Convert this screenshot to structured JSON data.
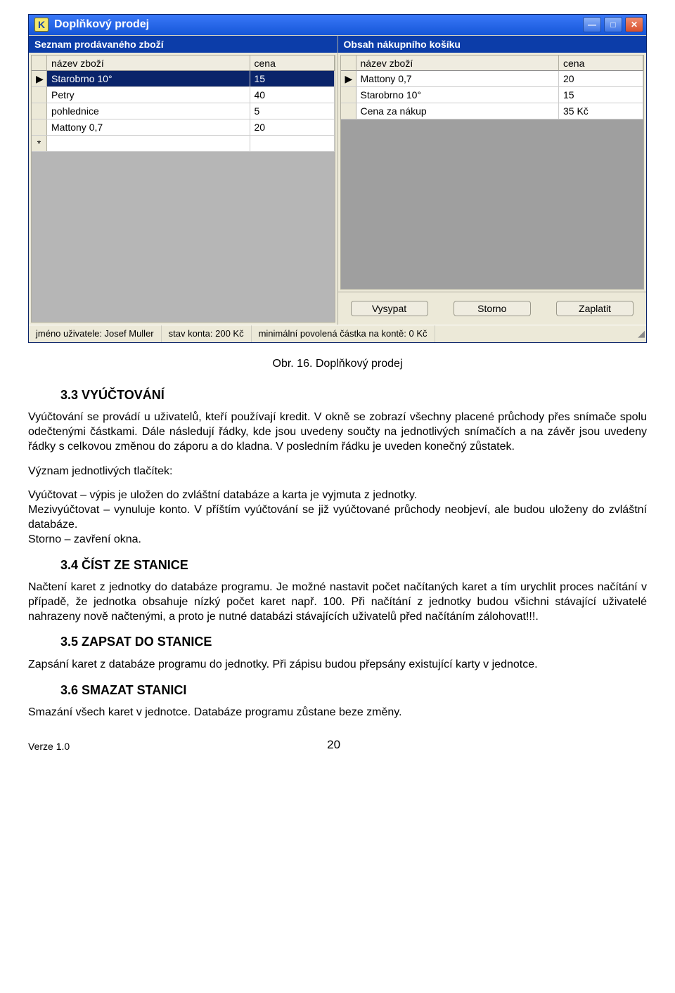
{
  "window": {
    "title": "Doplňkový prodej",
    "icon_letter": "K",
    "left_pane_title": "Seznam prodávaného zboží",
    "right_pane_title": "Obsah nákupního košíku",
    "columns": {
      "name": "název zboží",
      "price": "cena"
    },
    "left_rows": [
      {
        "ind": "▶",
        "name": "Starobrno 10°",
        "price": "15",
        "selected": true
      },
      {
        "ind": "",
        "name": "Petry",
        "price": "40"
      },
      {
        "ind": "",
        "name": "pohlednice",
        "price": "5"
      },
      {
        "ind": "",
        "name": "Mattony 0,7",
        "price": "20"
      },
      {
        "ind": "*",
        "name": "",
        "price": ""
      }
    ],
    "right_rows": [
      {
        "ind": "▶",
        "name": "Mattony 0,7",
        "price": "20"
      },
      {
        "ind": "",
        "name": "Starobrno 10°",
        "price": "15"
      },
      {
        "ind": "",
        "name": "Cena za nákup",
        "price": "35 Kč"
      }
    ],
    "buttons": {
      "dump": "Vysypat",
      "cancel": "Storno",
      "pay": "Zaplatit"
    },
    "status": {
      "user": "jméno uživatele: Josef Muller",
      "balance": "stav konta: 200 Kč",
      "min": "minimální povolená částka na kontě: 0 Kč"
    }
  },
  "doc": {
    "caption": "Obr. 16. Doplňkový prodej",
    "h33": "3.3   VYÚČTOVÁNÍ",
    "p1": "Vyúčtování se provádí u uživatelů, kteří používají kredit. V okně se zobrazí všechny placené průchody přes snímače spolu odečtenými částkami. Dále následují řádky, kde jsou uvedeny součty na jednotlivých snímačích a na závěr jsou uvedeny řádky s celkovou změnou do záporu a do kladna. V posledním řádku je uveden konečný zůstatek.",
    "p2": "Význam jednotlivých tlačítek:",
    "p3": "Vyúčtovat – výpis je uložen do zvláštní databáze a karta je vyjmuta z jednotky.",
    "p4": "Mezivyúčtovat – vynuluje konto. V příštím vyúčtování se již vyúčtované průchody neobjeví, ale budou uloženy do zvláštní databáze.",
    "p5": "Storno – zavření okna.",
    "h34": "3.4   ČÍST ZE STANICE",
    "p6": "Načtení karet z jednotky do databáze programu. Je možné nastavit počet načítaných karet a tím urychlit proces načítání v případě, že jednotka obsahuje nízký počet karet např. 100. Při načítání z jednotky budou všichni stávající uživatelé nahrazeny nově načtenými, a proto je nutné databázi stávajících uživatelů před načítáním zálohovat!!!.",
    "h35": "3.5   ZAPSAT DO STANICE",
    "p7": "Zapsání karet z databáze programu do jednotky. Při zápisu budou přepsány existující karty v jednotce.",
    "h36": "3.6   SMAZAT STANICI",
    "p8": "Smazání všech karet v jednotce. Databáze programu zůstane beze změny.",
    "footer_left": "Verze 1.0",
    "footer_right": "20"
  }
}
